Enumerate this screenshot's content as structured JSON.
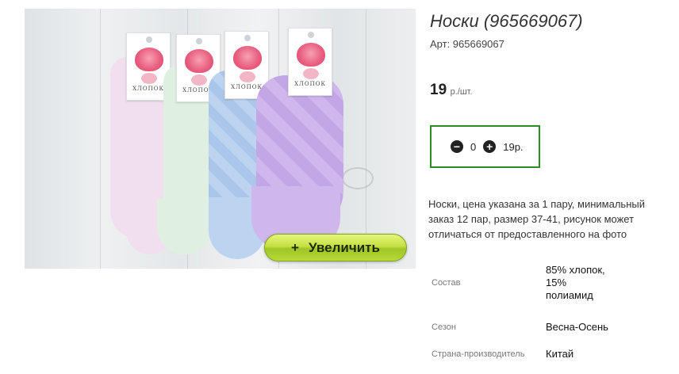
{
  "product": {
    "title": "Носки (965669067)",
    "sku_label": "Арт: 965669067",
    "price": "19",
    "price_unit": "р./шт.",
    "description": "Носки, цена указана за 1 пару, минимальный заказ 12 пар, размер 37-41, рисунок может отличаться от предоставленного на фото"
  },
  "image": {
    "zoom_label": "Увеличить",
    "zoom_icon": "plus-icon",
    "tag_text": "ХЛОПОК",
    "sock_colors": [
      "#f1dff0",
      "#dff0e2",
      "#bcd4f0",
      "#cfb6ec"
    ]
  },
  "cart": {
    "quantity": "0",
    "sum": "19р.",
    "minus_icon": "minus-circle-icon",
    "plus_icon": "plus-circle-icon",
    "border_color": "#2d8a24"
  },
  "properties": [
    {
      "key": "Состав",
      "value": "85% хлопок, 15% полиамид"
    },
    {
      "key": "Сезон",
      "value": "Весна-Осень"
    },
    {
      "key": "Страна-производитель",
      "value": "Китай"
    }
  ]
}
